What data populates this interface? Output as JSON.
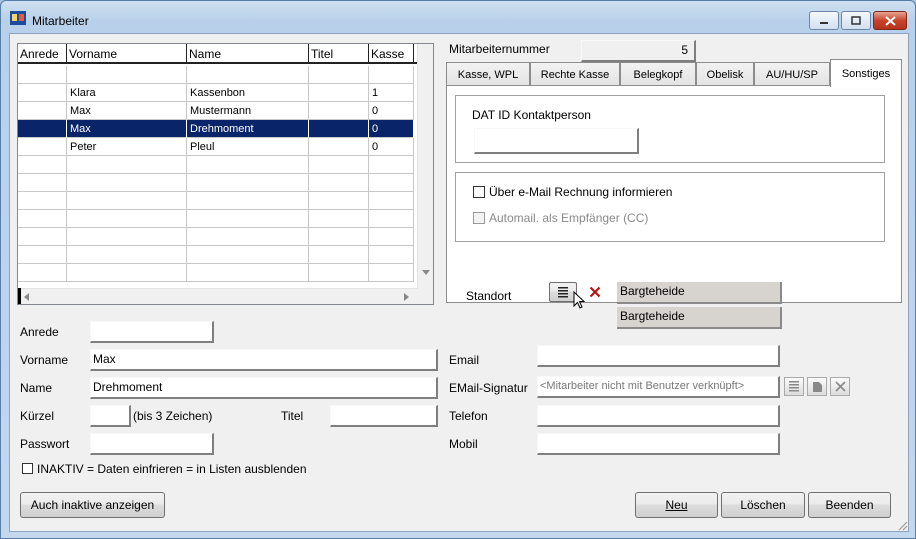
{
  "window": {
    "title": "Mitarbeiter"
  },
  "grid": {
    "columns": [
      "Anrede",
      "Vorname",
      "Name",
      "Titel",
      "Kasse"
    ],
    "rows": [
      {
        "anrede": "",
        "vorname": "",
        "name": "",
        "titel": "",
        "kasse": ""
      },
      {
        "anrede": "",
        "vorname": "Klara",
        "name": "Kassenbon",
        "titel": "",
        "kasse": "1"
      },
      {
        "anrede": "",
        "vorname": "Max",
        "name": "Mustermann",
        "titel": "",
        "kasse": "0"
      },
      {
        "anrede": "",
        "vorname": "Max",
        "name": "Drehmoment",
        "titel": "",
        "kasse": "0",
        "selected": true
      },
      {
        "anrede": "",
        "vorname": "Peter",
        "name": "Pleul",
        "titel": "",
        "kasse": "0"
      }
    ]
  },
  "mitarbeiternummer": {
    "label": "Mitarbeiternummer",
    "value": "5"
  },
  "tabs": [
    "Kasse, WPL",
    "Rechte Kasse",
    "Belegkopf",
    "Obelisk",
    "AU/HU/SP",
    "Sonstiges"
  ],
  "active_tab": "Sonstiges",
  "sonstiges": {
    "dat_id_label": "DAT ID Kontaktperson",
    "dat_id_value": "",
    "email_rechnung_label": "Über e-Mail Rechnung informieren",
    "automail_label": "Automail. als Empfänger (CC)",
    "standort_label": "Standort",
    "standort_value_1": "Bargteheide",
    "standort_value_2": "Bargteheide"
  },
  "form": {
    "anrede": {
      "label": "Anrede",
      "value": ""
    },
    "vorname": {
      "label": "Vorname",
      "value": "Max"
    },
    "name": {
      "label": "Name",
      "value": "Drehmoment"
    },
    "kuerzel": {
      "label": "Kürzel",
      "value": "",
      "hint": "(bis 3 Zeichen)"
    },
    "titel": {
      "label": "Titel",
      "value": ""
    },
    "passwort": {
      "label": "Passwort",
      "value": ""
    },
    "inaktiv_label": "INAKTIV = Daten einfrieren = in Listen ausblenden",
    "email": {
      "label": "Email",
      "value": ""
    },
    "email_signatur": {
      "label": "EMail-Signatur",
      "value": "<Mitarbeiter nicht mit Benutzer verknüpft>"
    },
    "telefon": {
      "label": "Telefon",
      "value": ""
    },
    "mobil": {
      "label": "Mobil",
      "value": ""
    }
  },
  "buttons": {
    "inaktive": "Auch inaktive anzeigen",
    "neu": "Neu",
    "loeschen": "Löschen",
    "beenden": "Beenden"
  }
}
